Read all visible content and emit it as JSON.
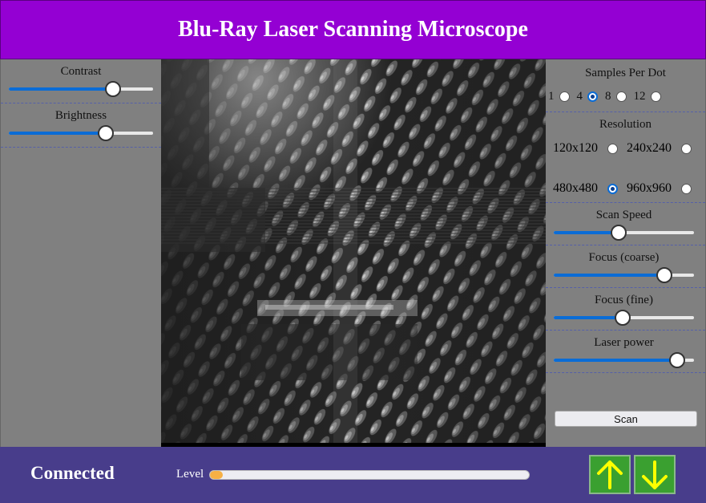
{
  "header": {
    "title": "Blu-Ray Laser Scanning Microscope"
  },
  "left_panel": {
    "sliders": [
      {
        "label": "Contrast",
        "value": 0.72
      },
      {
        "label": "Brightness",
        "value": 0.67
      }
    ]
  },
  "right_panel": {
    "samples_per_dot": {
      "title": "Samples Per Dot",
      "options": [
        "1",
        "4",
        "8",
        "12"
      ],
      "selected": "4"
    },
    "resolution": {
      "title": "Resolution",
      "options": [
        "120x120",
        "240x240",
        "480x480",
        "960x960"
      ],
      "selected": "480x480"
    },
    "sliders": [
      {
        "label": "Scan Speed",
        "value": 0.46
      },
      {
        "label": "Focus (coarse)",
        "value": 0.79
      },
      {
        "label": "Focus (fine)",
        "value": 0.49
      },
      {
        "label": "Laser power",
        "value": 0.88
      }
    ],
    "scan_label": "Scan"
  },
  "footer": {
    "status": "Connected",
    "level_label": "Level",
    "level_value": 0.04
  },
  "colors": {
    "header_bg": "#9400d3",
    "footer_bg": "#483d8b",
    "slider_fill": "#0a6cd6",
    "arrow_button": "#3aa030",
    "arrow_glyph": "#ffff00",
    "level_fill": "#f6b045"
  },
  "icons": {
    "up": "arrow-up-icon",
    "down": "arrow-down-icon"
  }
}
